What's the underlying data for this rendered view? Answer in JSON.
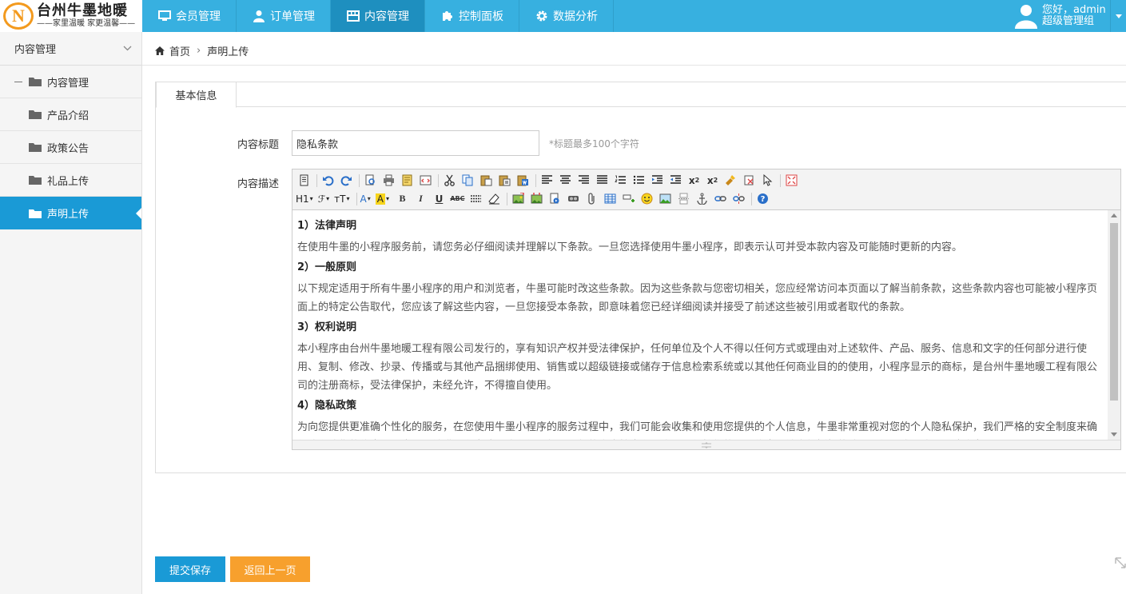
{
  "brand": {
    "logo_letter": "N",
    "name": "台州牛墨地暖",
    "slogan": "——家里温暖 家更温馨——"
  },
  "nav": [
    {
      "label": "会员管理",
      "icon": "monitor-icon"
    },
    {
      "label": "订单管理",
      "icon": "user-icon"
    },
    {
      "label": "内容管理",
      "icon": "grid-icon",
      "active": true
    },
    {
      "label": "控制面板",
      "icon": "puzzle-icon"
    },
    {
      "label": "数据分析",
      "icon": "gear-icon"
    }
  ],
  "user": {
    "greeting": "您好，admin",
    "role": "超级管理组"
  },
  "sidebar": {
    "header": "内容管理",
    "parent": "内容管理",
    "items": [
      "产品介绍",
      "政策公告",
      "礼品上传",
      "声明上传"
    ],
    "active_index": 3
  },
  "breadcrumb": {
    "home": "首页",
    "current": "声明上传"
  },
  "tab": {
    "label": "基本信息"
  },
  "form": {
    "title_label": "内容标题",
    "title_value": "隐私条款",
    "title_hint": "*标题最多100个字符",
    "desc_label": "内容描述"
  },
  "editor": {
    "toolbar_text": {
      "heading": "H1",
      "font": "ℱ",
      "size": "тT",
      "fontcolor": "A",
      "bgcolor": "A",
      "bold": "B",
      "italic": "I",
      "underline": "U",
      "strike": "ABC"
    },
    "sections": [
      {
        "heading": "1）法律声明",
        "body": "在使用牛墨的小程序服务前，请您务必仔细阅读并理解以下条款。一旦您选择使用牛墨小程序，即表示认可并受本款内容及可能随时更新的内容。"
      },
      {
        "heading": "2）一般原则",
        "body": "以下规定适用于所有牛墨小程序的用户和浏览者，牛墨可能时改这些条款。因为这些条款与您密切相关，您应经常访问本页面以了解当前条款，这些条款内容也可能被小程序页面上的特定公告取代，您应该了解这些内容，一旦您接受本条款，即意味着您已经详细阅读并接受了前述这些被引用或者取代的条款。"
      },
      {
        "heading": "3）权利说明",
        "body": "本小程序由台州牛墨地暖工程有限公司发行的，享有知识产权并受法律保护，任何单位及个人不得以任何方式或理由对上述软件、产品、服务、信息和文字的任何部分进行使用、复制、修改、抄录、传播或与其他产品捆绑使用、销售或以超级链接或储存于信息检索系统或以其他任何商业目的的使用，小程序显示的商标，是台州牛墨地暖工程有限公司的注册商标，受法律保护，未经允许，不得擅自使用。"
      },
      {
        "heading": "4）隐私政策",
        "body": "为向您提供更准确个性化的服务，在您使用牛墨小程序的服务过程中，我们可能会收集和使用您提供的个人信息，牛墨非常重视对您的个人隐私保护，我们严格的安全制度来确保我们收集的信息不丢失、不被滥用和变造，我们使用行业通行的安全技术和程序，来保护您的个人信息不被未经授权的访问、使用或者泄露，请注意"
      }
    ]
  },
  "buttons": {
    "save": "提交保存",
    "back": "返回上一页"
  },
  "colors": {
    "topbar": "#37b0e0",
    "active_nav": "#1e8fbf",
    "sidebar_active": "#1a9ad6",
    "save_button": "#1a9ad6",
    "back_button": "#f7a02d",
    "logo_accent": "#f39a1e"
  }
}
